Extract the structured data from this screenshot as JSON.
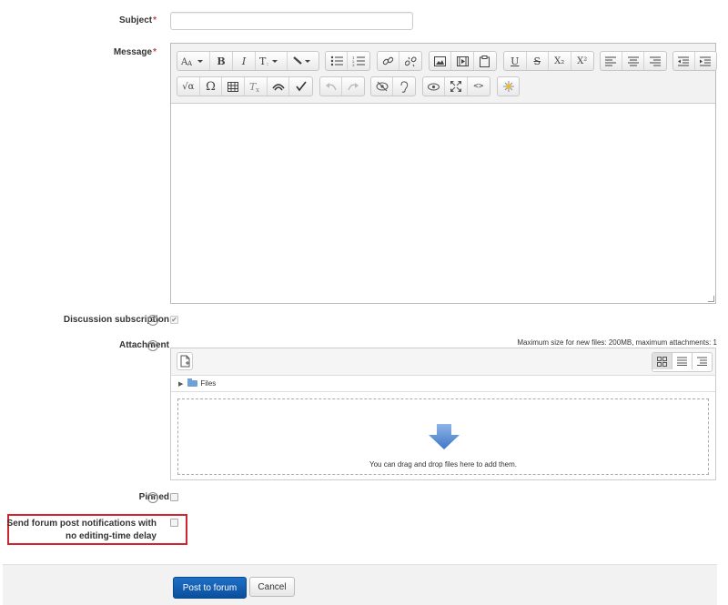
{
  "form": {
    "subject_label": "Subject",
    "required_mark": "*",
    "subject_value": "",
    "message_label": "Message",
    "discussion_subscription_label": "Discussion subscription",
    "attachment_label": "Attachment",
    "max_size_note": "Maximum size for new files: 200MB, maximum attachments: 1",
    "files_folder_label": "Files",
    "drop_hint": "You can drag and drop files here to add them.",
    "pinned_label": "Pinned",
    "notify_label_line1": "Send forum post notifications with",
    "notify_label_line2": "no editing-time delay",
    "help_glyph": "?",
    "discussion_subscription_checked": true,
    "pinned_checked": false,
    "notify_checked": false
  },
  "editor_toolbar": {
    "row1": [
      "font-size-icon",
      "bold-icon",
      "italic-icon",
      "text-style-icon",
      "draw-icon",
      "unordered-list-icon",
      "ordered-list-icon",
      "link-icon",
      "unlink-icon",
      "image-icon",
      "media-icon",
      "manage-files-icon",
      "underline-icon",
      "strikethrough-icon",
      "subscript-icon",
      "superscript-icon",
      "align-left-icon",
      "align-center-icon",
      "align-right-icon",
      "outdent-icon",
      "indent-icon"
    ],
    "row2": [
      "equation-icon",
      "special-character-icon",
      "table-icon",
      "clear-formatting-icon",
      "screenreader-helper-icon",
      "accessibility-checker-icon",
      "undo-icon",
      "redo-icon",
      "accessibility-icon",
      "ear-icon",
      "preview-icon",
      "fullscreen-icon",
      "html-icon",
      "sparkle-icon"
    ],
    "glyphs": {
      "bold": "B",
      "italic": "I",
      "underline": "U",
      "strike": "S",
      "sub": "X₂",
      "sup": "X²",
      "omega": "Ω",
      "sqrt": "√α",
      "code": "<>"
    }
  },
  "actions": {
    "submit_label": "Post to forum",
    "cancel_label": "Cancel"
  },
  "colors": {
    "primary": "#0f5db1",
    "required": "#b94a48",
    "highlight_box": "#d0262f"
  }
}
